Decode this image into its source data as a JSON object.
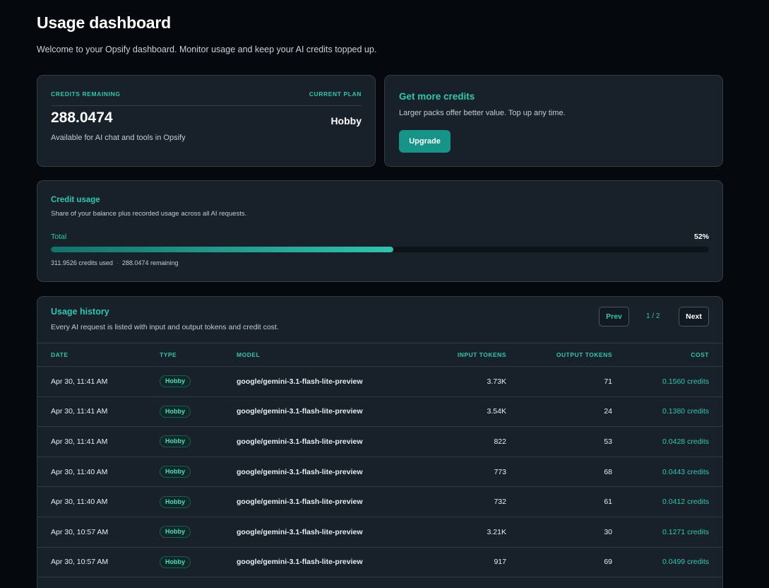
{
  "header": {
    "title": "Usage dashboard",
    "subtitle": "Welcome to your Opsify dashboard. Monitor usage and keep your AI credits topped up."
  },
  "credits": {
    "remaining_label": "CREDITS REMAINING",
    "plan_label": "CURRENT PLAN",
    "value": "288.0474",
    "plan": "Hobby",
    "description": "Available for AI chat and tools in Opsify"
  },
  "more_credits": {
    "title": "Get more credits",
    "description": "Larger packs offer better value. Top up any time.",
    "button_label": "Upgrade"
  },
  "usage": {
    "title": "Credit usage",
    "description": "Share of your balance plus recorded usage across all AI requests.",
    "total_label": "Total",
    "percent_label": "52%",
    "percent_value": 52,
    "used": "311.9526 credits used",
    "remaining": "288.0474 remaining"
  },
  "history": {
    "title": "Usage history",
    "description": "Every AI request is listed with input and output tokens and credit cost.",
    "prev_label": "Prev",
    "next_label": "Next",
    "page_indicator": "1 / 2",
    "columns": [
      "DATE",
      "TYPE",
      "MODEL",
      "INPUT TOKENS",
      "OUTPUT TOKENS",
      "COST"
    ],
    "rows": [
      {
        "date": "Apr 30, 11:41 AM",
        "type": "Hobby",
        "model": "google/gemini-3.1-flash-lite-preview",
        "input": "3.73K",
        "output": "71",
        "cost": "0.1560 credits"
      },
      {
        "date": "Apr 30, 11:41 AM",
        "type": "Hobby",
        "model": "google/gemini-3.1-flash-lite-preview",
        "input": "3.54K",
        "output": "24",
        "cost": "0.1380 credits"
      },
      {
        "date": "Apr 30, 11:41 AM",
        "type": "Hobby",
        "model": "google/gemini-3.1-flash-lite-preview",
        "input": "822",
        "output": "53",
        "cost": "0.0428 credits"
      },
      {
        "date": "Apr 30, 11:40 AM",
        "type": "Hobby",
        "model": "google/gemini-3.1-flash-lite-preview",
        "input": "773",
        "output": "68",
        "cost": "0.0443 credits"
      },
      {
        "date": "Apr 30, 11:40 AM",
        "type": "Hobby",
        "model": "google/gemini-3.1-flash-lite-preview",
        "input": "732",
        "output": "61",
        "cost": "0.0412 credits"
      },
      {
        "date": "Apr 30, 10:57 AM",
        "type": "Hobby",
        "model": "google/gemini-3.1-flash-lite-preview",
        "input": "3.21K",
        "output": "30",
        "cost": "0.1271 credits"
      },
      {
        "date": "Apr 30, 10:57 AM",
        "type": "Hobby",
        "model": "google/gemini-3.1-flash-lite-preview",
        "input": "917",
        "output": "69",
        "cost": "0.0499 credits"
      }
    ]
  },
  "colors": {
    "accent": "#2cc8b0",
    "button": "#159487",
    "background": "#05080d",
    "card": "#182029"
  }
}
